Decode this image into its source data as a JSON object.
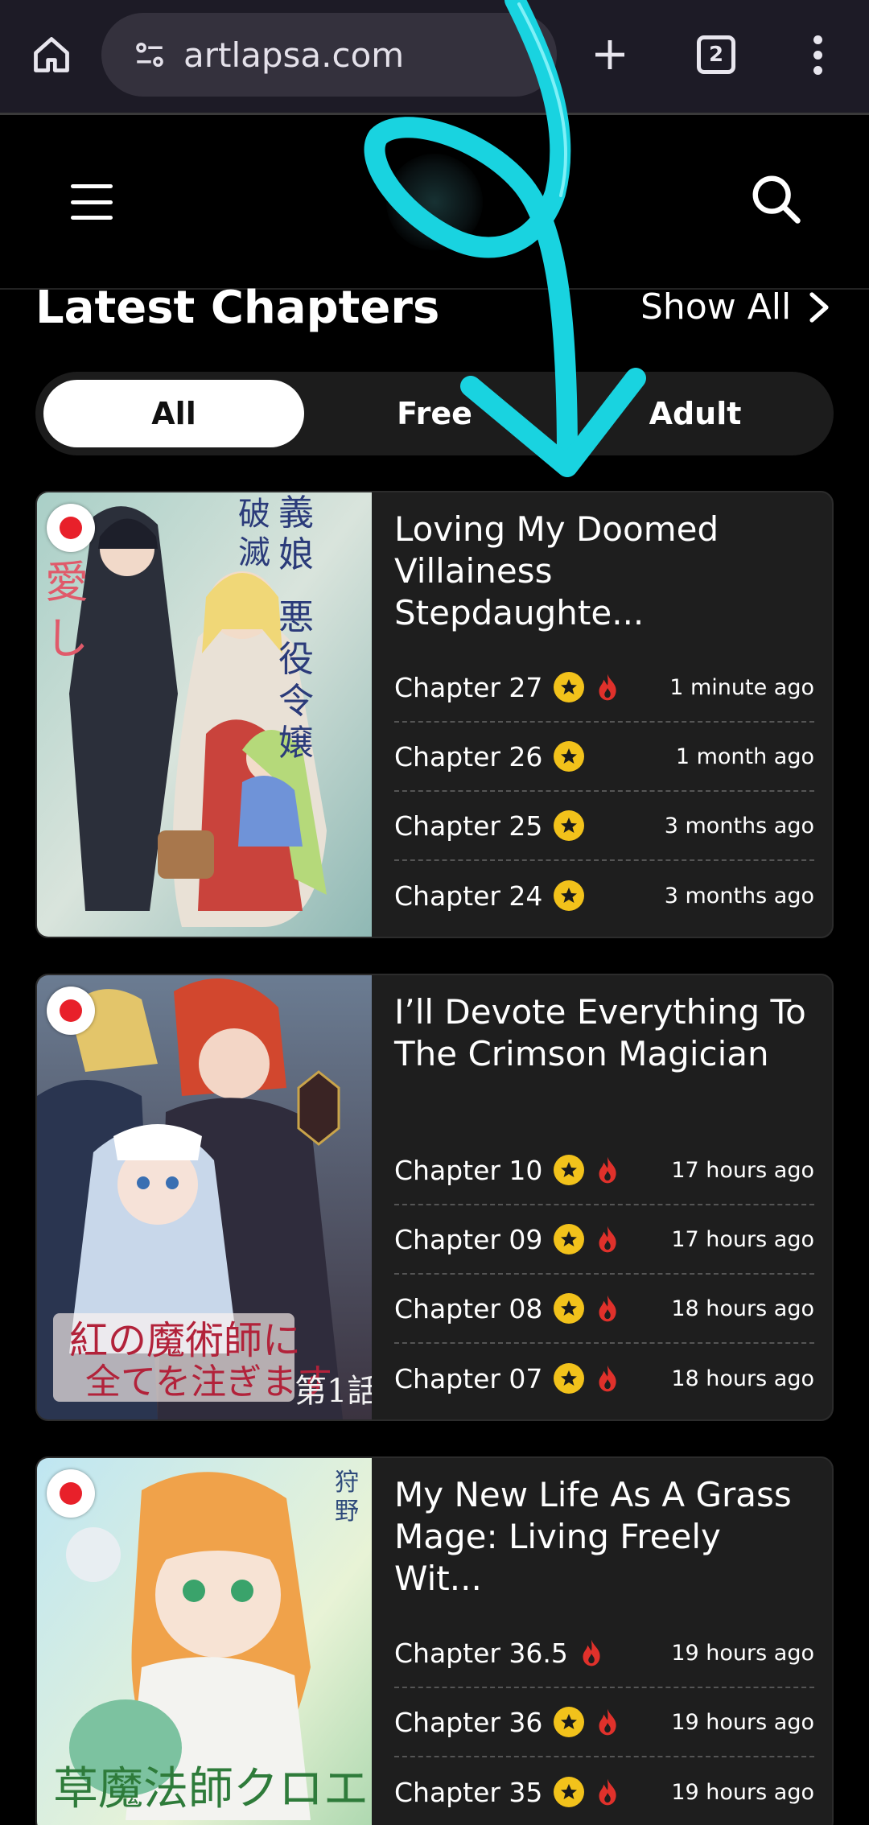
{
  "browser": {
    "url": "artlapsa.com",
    "tab_count": "2"
  },
  "site": {
    "section_title": "Latest Chapters",
    "show_all": "Show All",
    "filters": [
      "All",
      "Free",
      "Adult"
    ],
    "active_filter": "All"
  },
  "colors": {
    "background": "#000000",
    "card": "#1e1e1e",
    "star": "#f2c21b",
    "fire": "#e0312b",
    "annotation": "#19d3e0"
  },
  "icons": [
    "home-icon",
    "site-info-icon",
    "new-tab-icon",
    "tab-switcher-icon",
    "more-menu-icon",
    "hamburger-menu-icon",
    "search-icon",
    "chevron-right-icon",
    "japan-flag-icon",
    "star-icon",
    "fire-icon"
  ],
  "cards": [
    {
      "title": "Loving My Doomed Villainess Stepdaughte...",
      "chapters": [
        {
          "name": "Chapter 27",
          "star": true,
          "fire": true,
          "time": "1 minute ago"
        },
        {
          "name": "Chapter 26",
          "star": true,
          "fire": false,
          "time": "1 month ago"
        },
        {
          "name": "Chapter 25",
          "star": true,
          "fire": false,
          "time": "3 months ago"
        },
        {
          "name": "Chapter 24",
          "star": true,
          "fire": false,
          "time": "3 months ago"
        }
      ]
    },
    {
      "title": "I’ll Devote Everything To The Crimson Magician",
      "chapters": [
        {
          "name": "Chapter 10",
          "star": true,
          "fire": true,
          "time": "17 hours ago"
        },
        {
          "name": "Chapter 09",
          "star": true,
          "fire": true,
          "time": "17 hours ago"
        },
        {
          "name": "Chapter 08",
          "star": true,
          "fire": true,
          "time": "18 hours ago"
        },
        {
          "name": "Chapter 07",
          "star": true,
          "fire": true,
          "time": "18 hours ago"
        }
      ]
    },
    {
      "title": "My New Life As A Grass Mage: Living Freely Wit...",
      "chapters": [
        {
          "name": "Chapter 36.5",
          "star": false,
          "fire": true,
          "time": "19 hours ago"
        },
        {
          "name": "Chapter 36",
          "star": true,
          "fire": true,
          "time": "19 hours ago"
        },
        {
          "name": "Chapter 35",
          "star": true,
          "fire": true,
          "time": "19 hours ago"
        }
      ]
    }
  ]
}
